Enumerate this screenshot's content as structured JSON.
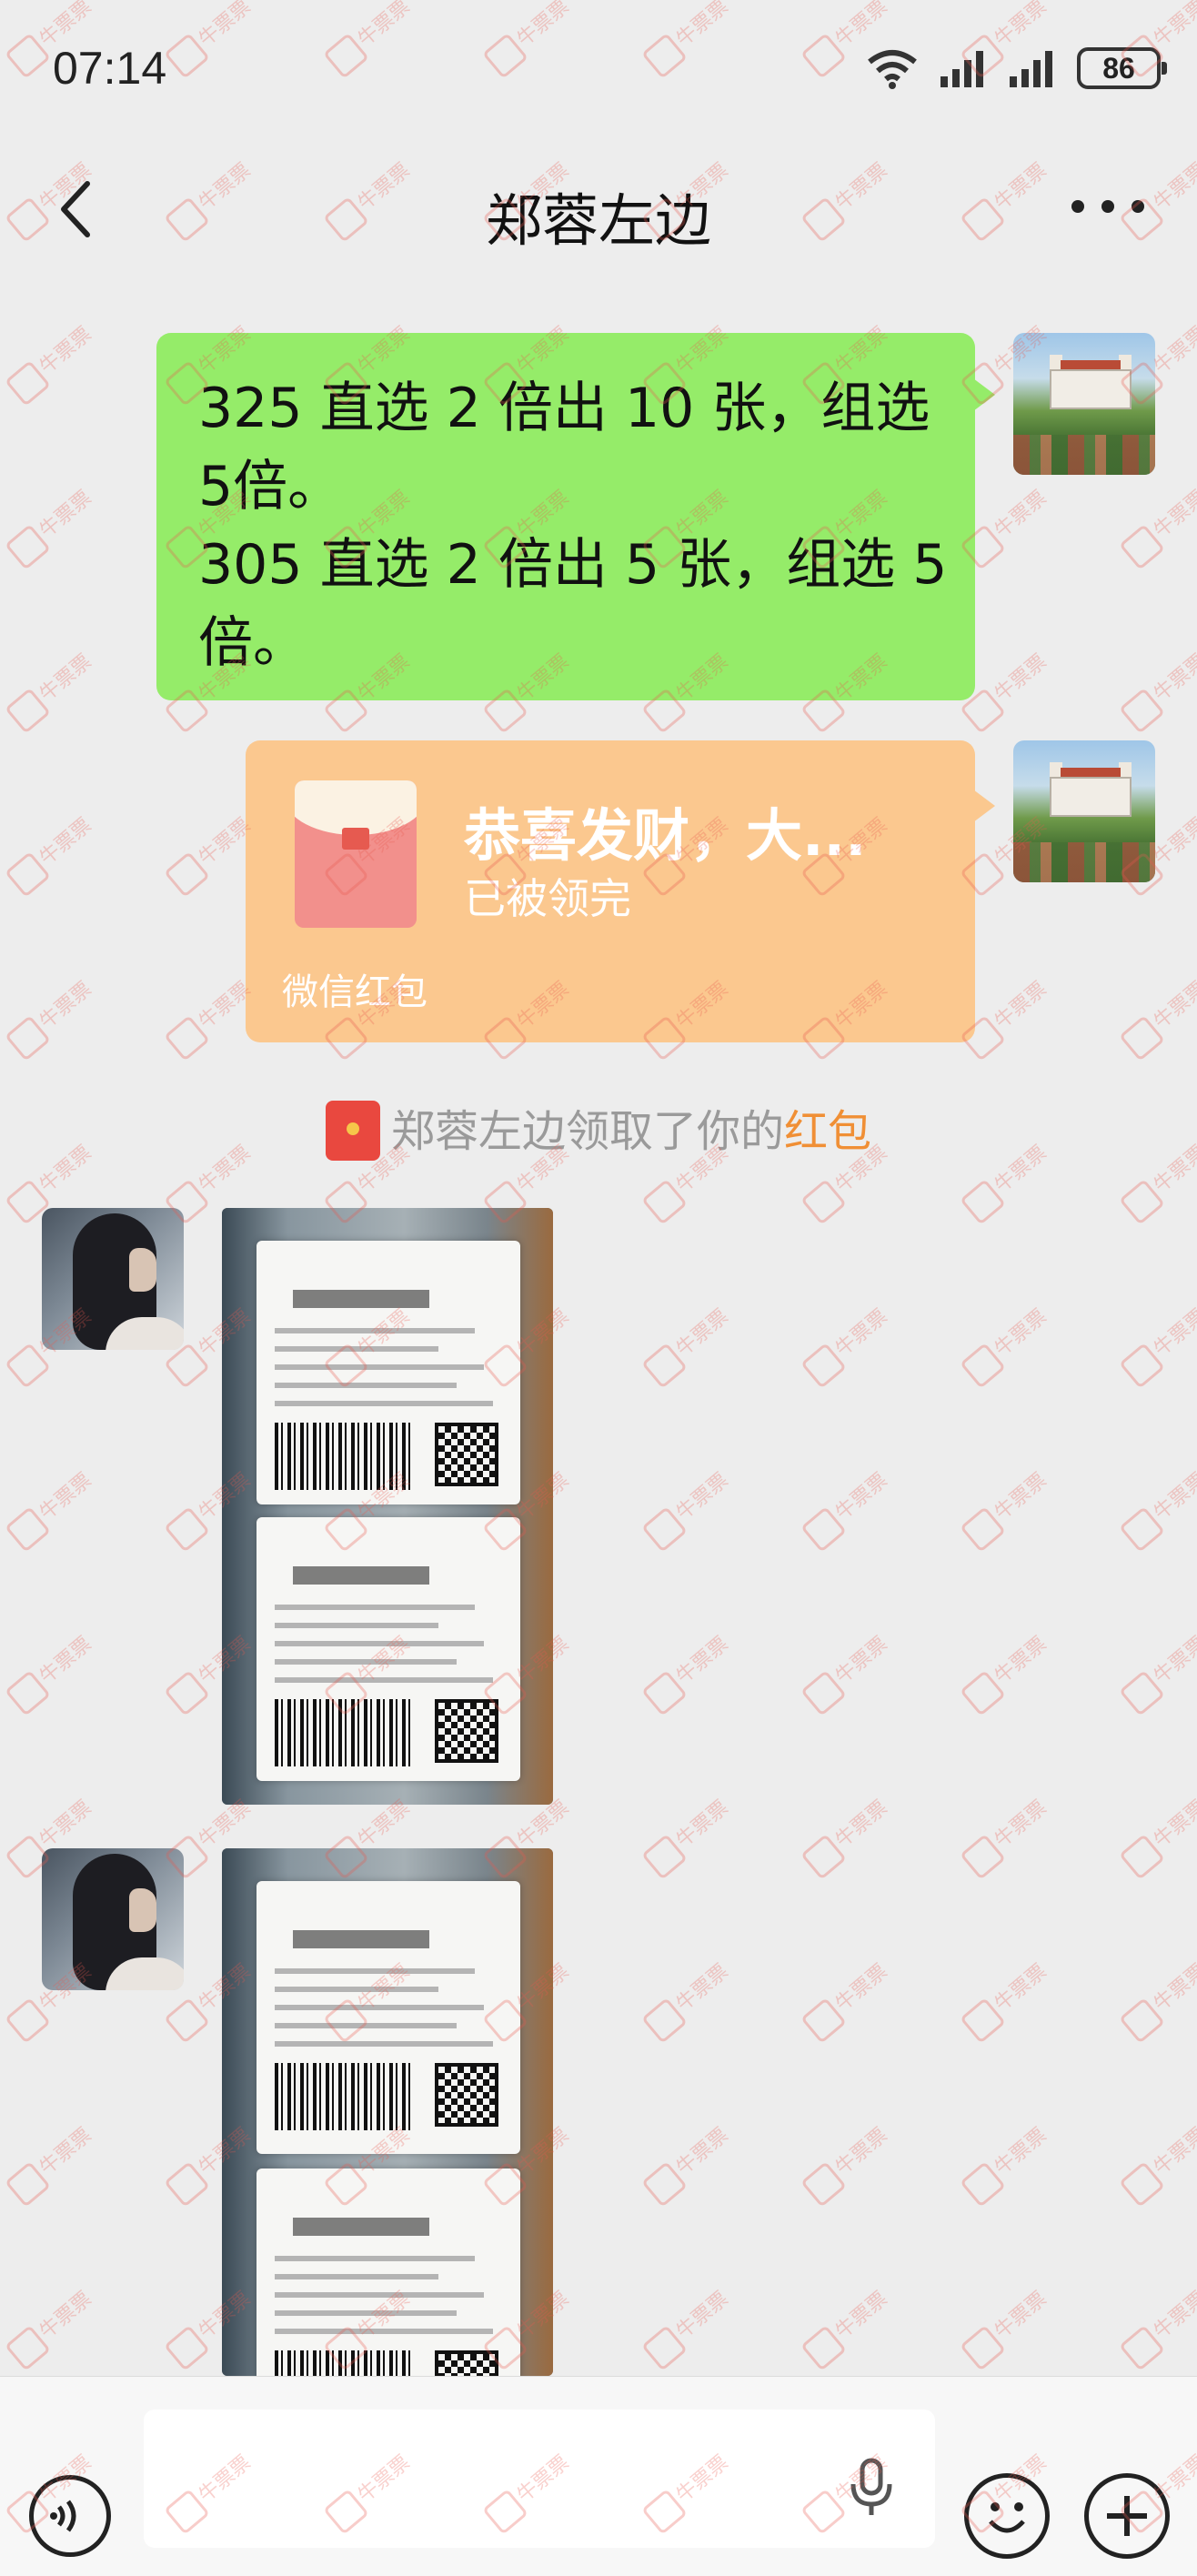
{
  "status_bar": {
    "time": "07:14",
    "battery": "86"
  },
  "header": {
    "title": "郑蓉左边"
  },
  "messages": {
    "text_lines": [
      "325 直选 2 倍出 10 张，组选",
      "5倍。",
      "305 直选 2 倍出 5 张，组选 5",
      "倍。"
    ],
    "red_packet": {
      "title": "恭喜发财，大...",
      "status": "已被领完",
      "footer": "微信红包"
    },
    "system_notice": {
      "prefix": "郑蓉左边领取了你的",
      "link": "红包"
    }
  },
  "watermark": {
    "text": "牛票票"
  },
  "colors": {
    "text_bubble": "#95ec69",
    "red_packet": "#fbc88f",
    "notice_link": "#f08f35",
    "background": "#ededed"
  },
  "icons": {
    "back": "chevron-left-icon",
    "more": "more-icon",
    "voice": "voice-icon",
    "mic": "microphone-icon",
    "emoji": "emoji-icon",
    "plus": "plus-icon"
  }
}
